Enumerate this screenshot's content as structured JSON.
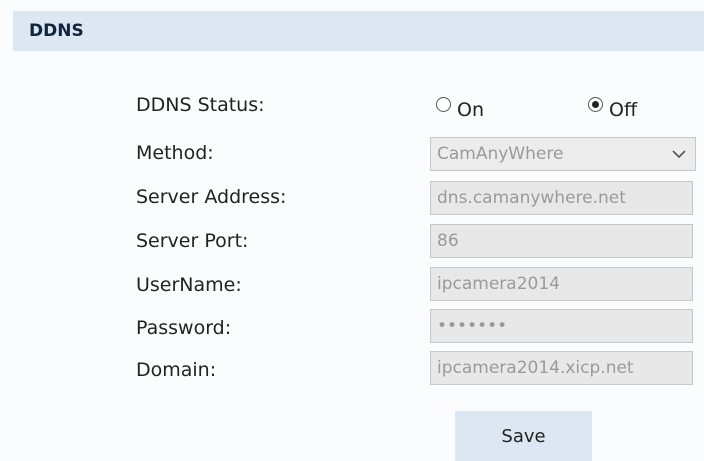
{
  "section": {
    "title": "DDNS"
  },
  "status": {
    "label": "DDNS Status:",
    "options": [
      {
        "label": "On",
        "selected": false
      },
      {
        "label": "Off",
        "selected": true
      }
    ]
  },
  "method": {
    "label": "Method:",
    "value": "CamAnyWhere"
  },
  "server_address": {
    "label": "Server Address:",
    "value": "dns.camanywhere.net"
  },
  "server_port": {
    "label": "Server Port:",
    "value": "86"
  },
  "username": {
    "label": "UserName:",
    "value": "ipcamera2014"
  },
  "password": {
    "label": "Password:",
    "value": "1234567"
  },
  "domain": {
    "label": "Domain:",
    "value": "ipcamera2014.xicp.net"
  },
  "save": {
    "label": "Save"
  },
  "colors": {
    "header_bg": "#dde7f3",
    "field_bg": "#e8e8e8",
    "field_text": "#9a9a9a"
  }
}
